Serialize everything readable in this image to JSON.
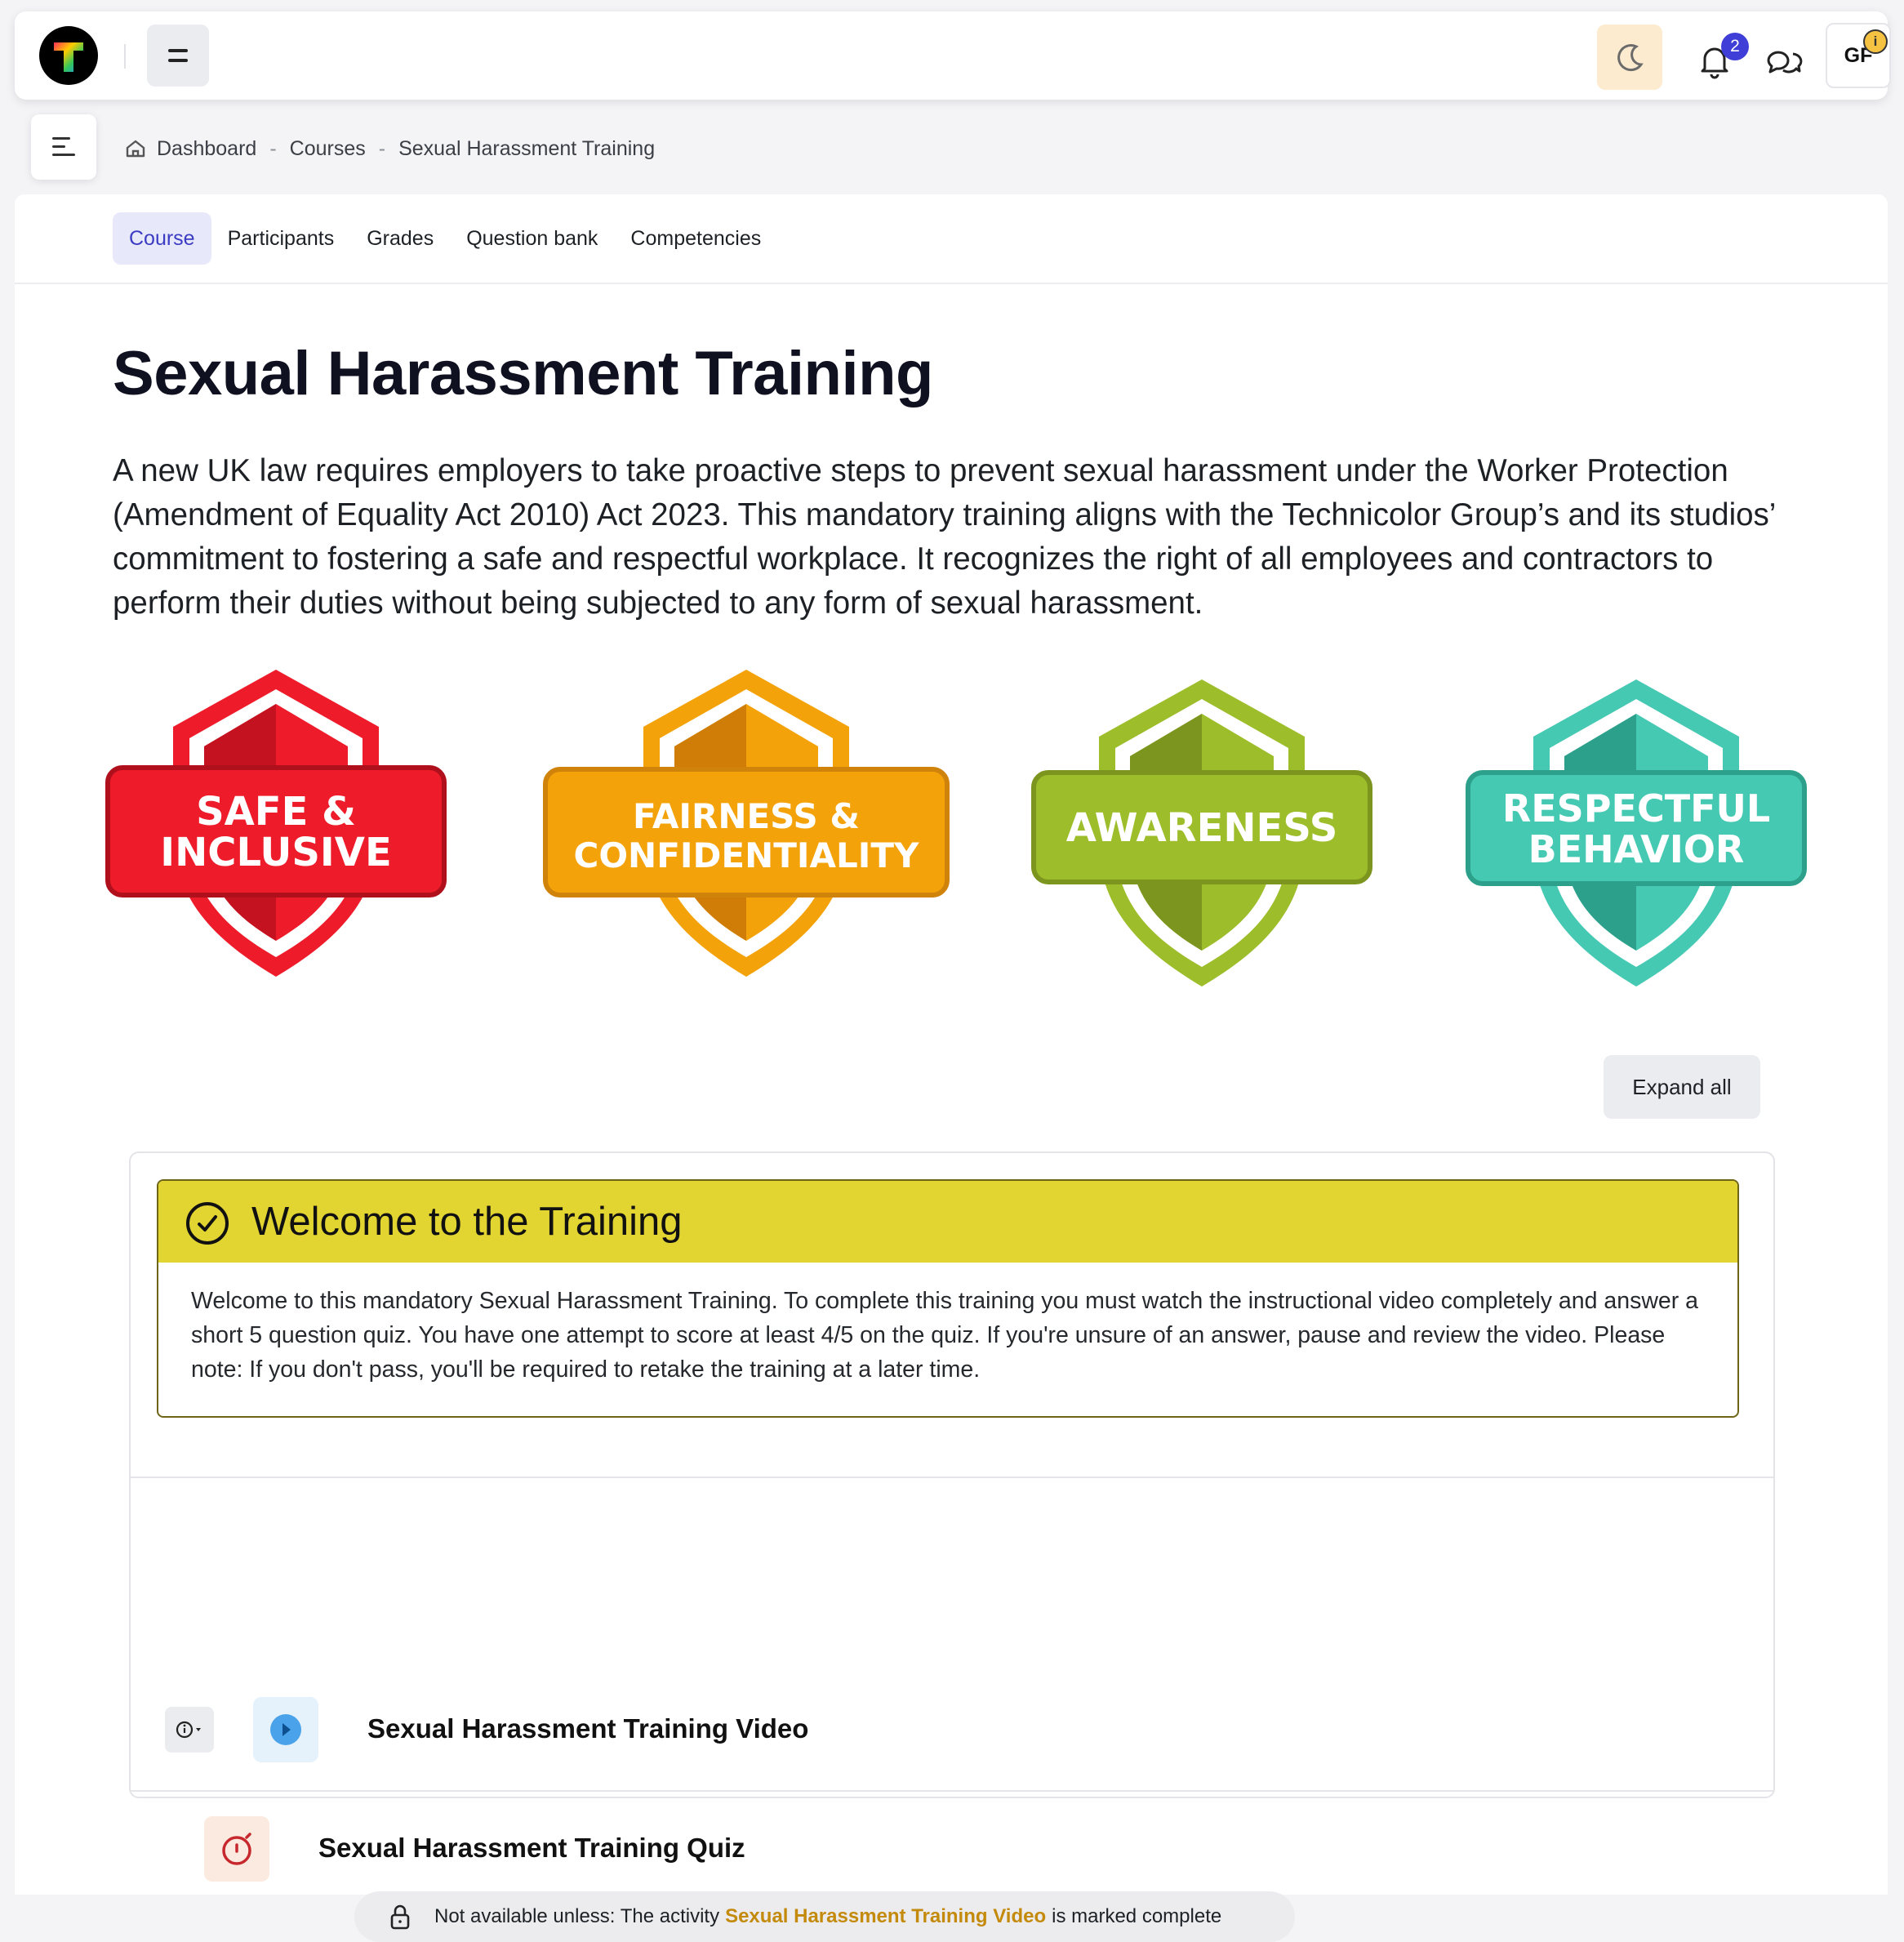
{
  "navbar": {
    "logo_letter": "T",
    "notification_count": "2",
    "avatar_initials": "GF",
    "avatar_warning_glyph": "i",
    "icons": [
      "hamburger-icon",
      "moon-icon",
      "bell-icon",
      "chat-icon",
      "warning-icon"
    ]
  },
  "breadcrumb": {
    "items": [
      "Dashboard",
      "Courses",
      "Sexual Harassment Training"
    ],
    "separator": "-"
  },
  "tabs": [
    "Course",
    "Participants",
    "Grades",
    "Question bank",
    "Competencies"
  ],
  "active_tab": "Course",
  "course": {
    "title": "Sexual Harassment Training",
    "intro": "A new UK law requires employers to take proactive steps to prevent sexual harassment under the Worker Protection (Amendment of Equality Act 2010) Act 2023. This mandatory training aligns with the Technicolor Group’s and its studios’ commitment to fostering a safe and respectful workplace. It recognizes the right of all employees and contractors to perform their duties without being subjected to any form of sexual harassment."
  },
  "badges": [
    {
      "line1": "SAFE &",
      "line2": "INCLUSIVE",
      "color": "#ee1c2a",
      "dark": "#c41220"
    },
    {
      "line1": "FAIRNESS &",
      "line2": "CONFIDENTIALITY",
      "color": "#f4a20a",
      "dark": "#cf7d06"
    },
    {
      "line1": "AWARENESS",
      "line2": "",
      "color": "#9dbd2a",
      "dark": "#7c951e"
    },
    {
      "line1": "RESPECTFUL",
      "line2": "BEHAVIOR",
      "color": "#45c9b3",
      "dark": "#2da08b"
    }
  ],
  "expand_all_label": "Expand all",
  "section": {
    "title": "Welcome to the Training",
    "body": "Welcome to this mandatory Sexual Harassment Training. To complete this training you must watch the instructional video completely and answer a short 5 question quiz. You have one attempt to score at least 4/5 on the quiz. If you're unsure of an answer, pause and review the video. Please note: If you don't pass, you'll be required to retake the training at a later time.",
    "header_color": "#e3d531"
  },
  "activities": {
    "video_title": "Sexual Harassment Training Video",
    "quiz_title": "Sexual Harassment Training Quiz",
    "restriction_prefix": "Not available unless: The activity",
    "restriction_link": "Sexual Harassment Training Video",
    "restriction_suffix": "is marked complete"
  },
  "colors": {
    "accent": "#3b3bc4",
    "badge_blue": "#3f3fd8",
    "link_gold": "#c48a0c",
    "quiz_red": "#c6282d"
  }
}
